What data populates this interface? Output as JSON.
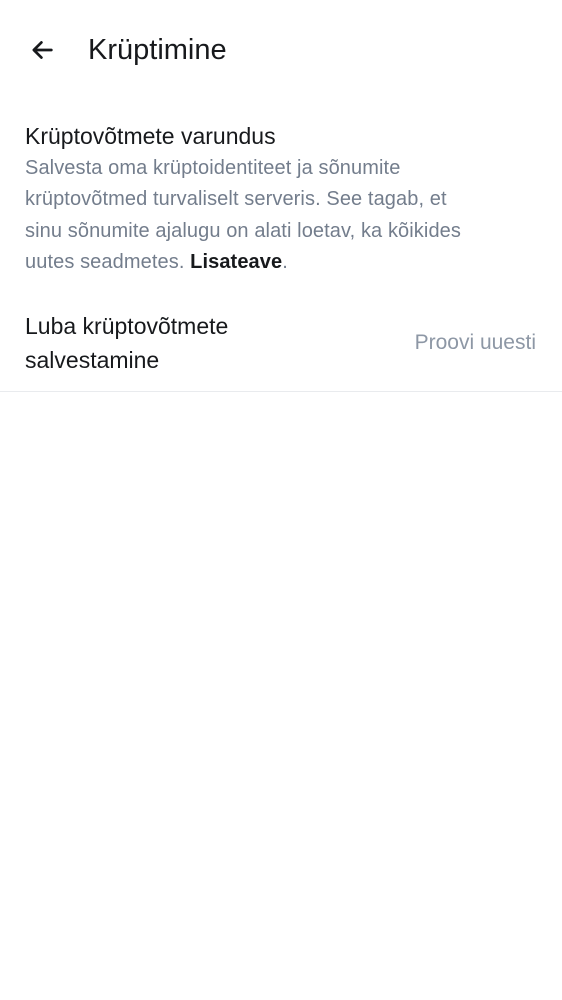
{
  "header": {
    "title": "Krüptimine",
    "back_icon": "arrow-left-icon"
  },
  "key_backup": {
    "title": "Krüptovõtmete varundus",
    "description_lines": [
      "Salvesta oma krüptoidentiteet ja sõnumite",
      "krüptovõtmed turvaliselt serveris. See tagab, et",
      "sinu sõnumite ajalugu on alati loetav, ka kõikides",
      "uutes seadmetes. "
    ],
    "learn_more": "Lisateave",
    "period": "."
  },
  "setting": {
    "label_lines": [
      "Luba krüptovõtmete",
      "salvestamine"
    ],
    "action": "Proovi uuesti"
  }
}
